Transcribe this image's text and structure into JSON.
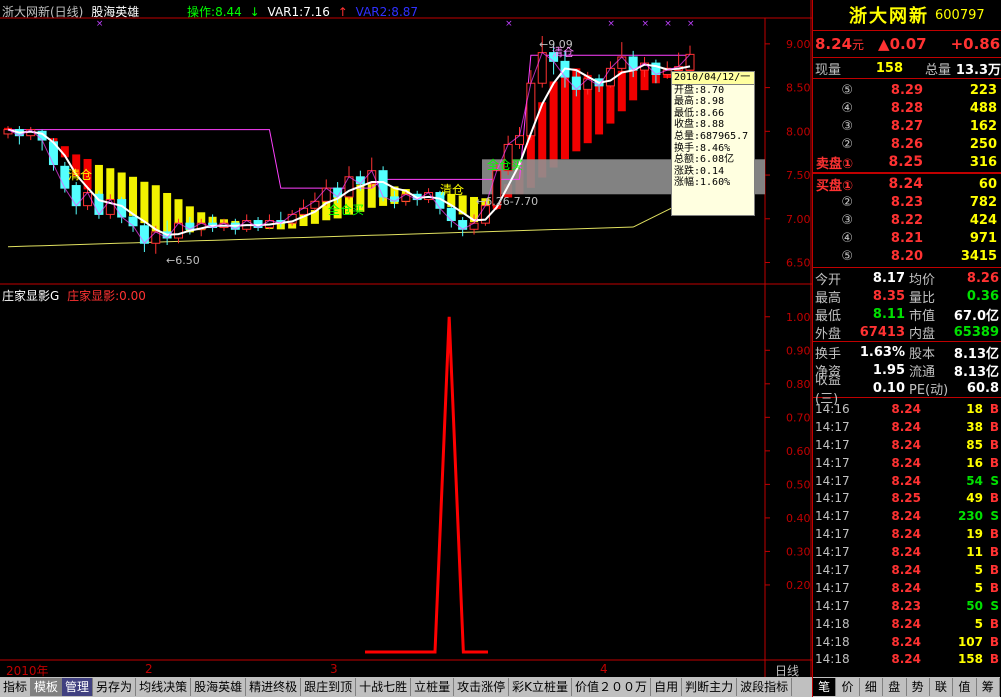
{
  "header": {
    "stock_title": "浙大网新(日线)",
    "indicator_name": "股海英雄",
    "op_label": "操作:8.44",
    "var1_label": "VAR1:7.16",
    "var2_label": "VAR2:8.87"
  },
  "sub_header": {
    "name": "庄家显影G",
    "value_label": "庄家显影:0.00"
  },
  "annotations": {
    "clear1": "清仓",
    "clear2": "清仓",
    "buy1": "全仓买",
    "buy2": "全仓买",
    "low_label": "←6.50",
    "mid_label": "←6.26-7.70",
    "high_label": "←9.09",
    "clear3": "清仓"
  },
  "tooltip": {
    "date": "2010/04/12/一",
    "open": "开盘:8.70",
    "high": "最高:8.98",
    "low": "最低:8.66",
    "close": "收盘:8.88",
    "volume": "总量:687965.7",
    "turnover": "换手:8.46%",
    "amount": "总额:6.08亿",
    "change": "涨跌:0.14",
    "pct": "涨幅:1.60%"
  },
  "x_axis": {
    "year": "2010年",
    "m2": "2",
    "m3": "3",
    "m4": "4",
    "period": "日线"
  },
  "chart_data": [
    {
      "type": "candlestick",
      "title": "",
      "y_ticks": [
        "9.00",
        "8.50",
        "8.00",
        "7.50",
        "7.00",
        "6.50"
      ],
      "ylim": [
        6.3,
        9.25
      ],
      "candles": [
        {
          "o": 7.97,
          "c": 8.02,
          "h": 8.06,
          "l": 7.92
        },
        {
          "o": 8.02,
          "c": 7.95,
          "h": 8.06,
          "l": 7.85
        },
        {
          "o": 7.95,
          "c": 8.02,
          "h": 8.05,
          "l": 7.9
        },
        {
          "o": 8.0,
          "c": 7.9,
          "h": 8.02,
          "l": 7.78
        },
        {
          "o": 7.88,
          "c": 7.62,
          "h": 7.92,
          "l": 7.55
        },
        {
          "o": 7.6,
          "c": 7.35,
          "h": 7.65,
          "l": 7.3
        },
        {
          "o": 7.38,
          "c": 7.15,
          "h": 7.42,
          "l": 7.05
        },
        {
          "o": 7.15,
          "c": 7.3,
          "h": 7.38,
          "l": 7.1
        },
        {
          "o": 7.28,
          "c": 7.05,
          "h": 7.32,
          "l": 7.0
        },
        {
          "o": 7.05,
          "c": 7.22,
          "h": 7.28,
          "l": 7.0
        },
        {
          "o": 7.22,
          "c": 7.02,
          "h": 7.25,
          "l": 6.95
        },
        {
          "o": 7.02,
          "c": 6.92,
          "h": 7.06,
          "l": 6.85
        },
        {
          "o": 6.92,
          "c": 6.72,
          "h": 6.95,
          "l": 6.62
        },
        {
          "o": 6.72,
          "c": 6.85,
          "h": 6.92,
          "l": 6.6
        },
        {
          "o": 6.85,
          "c": 6.78,
          "h": 6.98,
          "l": 6.7
        },
        {
          "o": 6.78,
          "c": 6.95,
          "h": 7.0,
          "l": 6.72
        },
        {
          "o": 6.95,
          "c": 6.88,
          "h": 7.02,
          "l": 6.82
        },
        {
          "o": 6.88,
          "c": 6.95,
          "h": 7.0,
          "l": 6.8
        },
        {
          "o": 6.95,
          "c": 6.9,
          "h": 7.05,
          "l": 6.85
        },
        {
          "o": 6.9,
          "c": 6.95,
          "h": 7.0,
          "l": 6.86
        },
        {
          "o": 6.95,
          "c": 6.88,
          "h": 7.0,
          "l": 6.82
        },
        {
          "o": 6.88,
          "c": 6.98,
          "h": 7.05,
          "l": 6.85
        },
        {
          "o": 6.98,
          "c": 6.9,
          "h": 7.02,
          "l": 6.86
        },
        {
          "o": 6.9,
          "c": 6.98,
          "h": 7.05,
          "l": 6.88
        },
        {
          "o": 6.98,
          "c": 6.95,
          "h": 7.08,
          "l": 6.9
        },
        {
          "o": 6.95,
          "c": 7.05,
          "h": 7.1,
          "l": 6.92
        },
        {
          "o": 7.05,
          "c": 7.12,
          "h": 7.22,
          "l": 7.02
        },
        {
          "o": 7.12,
          "c": 7.2,
          "h": 7.3,
          "l": 7.08
        },
        {
          "o": 7.2,
          "c": 7.35,
          "h": 7.45,
          "l": 7.15
        },
        {
          "o": 7.35,
          "c": 7.25,
          "h": 7.42,
          "l": 7.18
        },
        {
          "o": 7.25,
          "c": 7.48,
          "h": 7.6,
          "l": 7.22
        },
        {
          "o": 7.48,
          "c": 7.4,
          "h": 7.55,
          "l": 7.32
        },
        {
          "o": 7.4,
          "c": 7.55,
          "h": 7.7,
          "l": 7.35
        },
        {
          "o": 7.55,
          "c": 7.25,
          "h": 7.6,
          "l": 7.2
        },
        {
          "o": 7.25,
          "c": 7.2,
          "h": 7.32,
          "l": 7.12
        },
        {
          "o": 7.2,
          "c": 7.28,
          "h": 7.32,
          "l": 7.15
        },
        {
          "o": 7.28,
          "c": 7.22,
          "h": 7.32,
          "l": 7.15
        },
        {
          "o": 7.22,
          "c": 7.3,
          "h": 7.35,
          "l": 7.18
        },
        {
          "o": 7.3,
          "c": 7.12,
          "h": 7.32,
          "l": 7.05
        },
        {
          "o": 7.12,
          "c": 6.98,
          "h": 7.15,
          "l": 6.9
        },
        {
          "o": 6.98,
          "c": 6.88,
          "h": 7.02,
          "l": 6.8
        },
        {
          "o": 6.88,
          "c": 6.95,
          "h": 7.05,
          "l": 6.82
        },
        {
          "o": 6.95,
          "c": 7.15,
          "h": 7.2,
          "l": 6.92
        },
        {
          "o": 7.15,
          "c": 7.55,
          "h": 7.65,
          "l": 7.1
        },
        {
          "o": 7.55,
          "c": 7.85,
          "h": 7.95,
          "l": 7.5
        },
        {
          "o": 7.85,
          "c": 7.95,
          "h": 8.05,
          "l": 7.8
        },
        {
          "o": 7.95,
          "c": 8.55,
          "h": 8.7,
          "l": 7.9
        },
        {
          "o": 8.55,
          "c": 8.9,
          "h": 9.09,
          "l": 8.5
        },
        {
          "o": 8.9,
          "c": 8.8,
          "h": 9.0,
          "l": 8.65
        },
        {
          "o": 8.8,
          "c": 8.62,
          "h": 8.92,
          "l": 8.5
        },
        {
          "o": 8.62,
          "c": 8.48,
          "h": 8.7,
          "l": 8.4
        },
        {
          "o": 8.48,
          "c": 8.6,
          "h": 8.68,
          "l": 8.42
        },
        {
          "o": 8.6,
          "c": 8.52,
          "h": 8.65,
          "l": 8.45
        },
        {
          "o": 8.52,
          "c": 8.72,
          "h": 8.8,
          "l": 8.5
        },
        {
          "o": 8.72,
          "c": 8.85,
          "h": 9.02,
          "l": 8.65
        },
        {
          "o": 8.85,
          "c": 8.7,
          "h": 8.92,
          "l": 8.62
        },
        {
          "o": 8.7,
          "c": 8.78,
          "h": 8.85,
          "l": 8.62
        },
        {
          "o": 8.78,
          "c": 8.65,
          "h": 8.82,
          "l": 8.55
        },
        {
          "o": 8.65,
          "c": 8.7,
          "h": 8.8,
          "l": 8.6
        },
        {
          "o": 8.7,
          "c": 8.74,
          "h": 8.9,
          "l": 8.62
        },
        {
          "o": 8.7,
          "c": 8.88,
          "h": 8.98,
          "l": 8.66
        }
      ]
    },
    {
      "type": "line",
      "title": "",
      "y_ticks": [
        "1.00",
        "0.90",
        "0.80",
        "0.70",
        "0.60",
        "0.50",
        "0.40",
        "0.30",
        "0.20"
      ],
      "ylim": [
        0,
        1.05
      ],
      "series": [
        {
          "values": [
            0,
            0,
            0,
            0,
            0,
            0,
            0,
            0,
            0,
            0,
            0,
            0,
            0,
            0,
            0,
            0,
            0,
            0,
            0,
            0,
            0,
            0,
            0,
            0,
            0,
            0,
            0,
            0,
            0,
            0,
            0,
            0,
            0,
            0,
            0,
            0,
            0,
            0,
            0,
            0,
            0,
            0,
            0,
            0,
            0,
            0,
            0,
            0,
            0,
            0,
            0,
            0,
            0,
            0,
            0,
            0,
            0,
            0,
            0,
            0,
            0
          ]
        }
      ],
      "spike": {
        "start": 24,
        "peak": 29,
        "end": 34
      },
      "line_start": 24,
      "line_end": 41
    }
  ],
  "toolbar": [
    "指标",
    "模板",
    "管理",
    "另存为",
    "均线决策",
    "股海英雄",
    "精进终极",
    "跟庄到顶",
    "十战七胜",
    "立桩量",
    "攻击涨停",
    "彩K立桩量",
    "价值２００万",
    "自用",
    "判断主力",
    "波段指标"
  ],
  "right_panel": {
    "name": "浙大网新",
    "code": "600797",
    "price": "8.24",
    "unit": "元",
    "change": "▲0.07",
    "pct": "+0.86",
    "vol_label": "现量",
    "vol": "158",
    "total_label": "总量",
    "total": "13.3万",
    "asks": [
      {
        "lbl": "⑤",
        "p": "8.29",
        "v": "223"
      },
      {
        "lbl": "④",
        "p": "8.28",
        "v": "488"
      },
      {
        "lbl": "③",
        "p": "8.27",
        "v": "162"
      },
      {
        "lbl": "②",
        "p": "8.26",
        "v": "250"
      },
      {
        "lbl": "卖盘①",
        "p": "8.25",
        "v": "316"
      }
    ],
    "bids": [
      {
        "lbl": "买盘①",
        "p": "8.24",
        "v": "60"
      },
      {
        "lbl": "②",
        "p": "8.23",
        "v": "782"
      },
      {
        "lbl": "③",
        "p": "8.22",
        "v": "424"
      },
      {
        "lbl": "④",
        "p": "8.21",
        "v": "971"
      },
      {
        "lbl": "⑤",
        "p": "8.20",
        "v": "3415"
      }
    ],
    "stats": [
      {
        "a": "今开",
        "b": "8.17",
        "bc": "wh",
        "c": "均价",
        "d": "8.26",
        "dc": "r"
      },
      {
        "a": "最高",
        "b": "8.35",
        "bc": "r",
        "c": "量比",
        "d": "0.36",
        "dc": "g"
      },
      {
        "a": "最低",
        "b": "8.11",
        "bc": "g",
        "c": "市值",
        "d": "67.0亿",
        "dc": "wh"
      },
      {
        "a": "外盘",
        "b": "67413",
        "bc": "r",
        "c": "内盘",
        "d": "65389",
        "dc": "g"
      }
    ],
    "stats2": [
      {
        "a": "换手",
        "b": "1.63%",
        "bc": "wh",
        "c": "股本",
        "d": "8.13亿",
        "dc": "wh"
      },
      {
        "a": "净资",
        "b": "1.95",
        "bc": "wh",
        "c": "流通",
        "d": "8.13亿",
        "dc": "wh"
      },
      {
        "a": "收益(三)",
        "b": "0.10",
        "bc": "wh",
        "c": "PE(动)",
        "d": "60.8",
        "dc": "wh"
      }
    ],
    "ticks": [
      {
        "t": "14:16",
        "p": "8.24",
        "v": "18",
        "s": "B"
      },
      {
        "t": "14:17",
        "p": "8.24",
        "v": "38",
        "s": "B"
      },
      {
        "t": "14:17",
        "p": "8.24",
        "v": "85",
        "s": "B"
      },
      {
        "t": "14:17",
        "p": "8.24",
        "v": "16",
        "s": "B"
      },
      {
        "t": "14:17",
        "p": "8.24",
        "v": "54",
        "s": "S"
      },
      {
        "t": "14:17",
        "p": "8.25",
        "v": "49",
        "s": "B"
      },
      {
        "t": "14:17",
        "p": "8.24",
        "v": "230",
        "s": "S"
      },
      {
        "t": "14:17",
        "p": "8.24",
        "v": "19",
        "s": "B"
      },
      {
        "t": "14:17",
        "p": "8.24",
        "v": "11",
        "s": "B"
      },
      {
        "t": "14:17",
        "p": "8.24",
        "v": "5",
        "s": "B"
      },
      {
        "t": "14:17",
        "p": "8.24",
        "v": "5",
        "s": "B"
      },
      {
        "t": "14:17",
        "p": "8.23",
        "v": "50",
        "s": "S"
      },
      {
        "t": "14:18",
        "p": "8.24",
        "v": "5",
        "s": "B"
      },
      {
        "t": "14:18",
        "p": "8.24",
        "v": "107",
        "s": "B"
      },
      {
        "t": "14:18",
        "p": "8.24",
        "v": "158",
        "s": "B"
      }
    ],
    "tabs": [
      "笔",
      "价",
      "细",
      "盘",
      "势",
      "联",
      "值",
      "筹"
    ]
  }
}
